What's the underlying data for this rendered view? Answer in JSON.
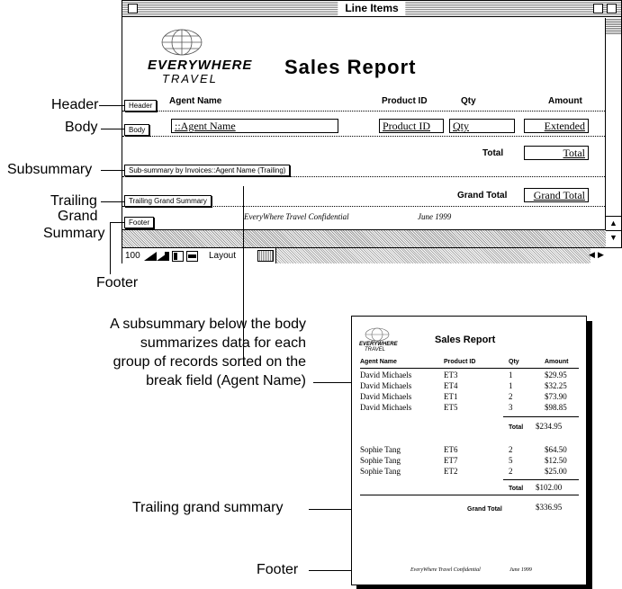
{
  "window": {
    "title": "Line Items",
    "logo_line1": "EVERYWHERE",
    "logo_line2": "TRAVEL",
    "report_title": "Sales Report",
    "headers": {
      "agent": "Agent Name",
      "product": "Product ID",
      "qty": "Qty",
      "amount": "Amount"
    },
    "part_tags": {
      "header": "Header",
      "body": "Body",
      "subsummary": "Sub-summary by Invoices::Agent Name (Trailing)",
      "grand": "Trailing Grand Summary",
      "footer": "Footer"
    },
    "fields": {
      "agent": "::Agent Name",
      "product": "Product ID",
      "qty": "Qty",
      "amount": "Extended",
      "total": "Total",
      "grand_total": "Grand Total"
    },
    "labels": {
      "total": "Total",
      "grand_total": "Grand Total"
    },
    "footer_text": "EveryWhere Travel Confidential",
    "footer_date": "June 1999",
    "status": {
      "zoom": "100",
      "mode": "Layout"
    }
  },
  "callouts": {
    "header": "Header",
    "body": "Body",
    "subsummary": "Subsummary",
    "trailing1": "Trailing",
    "trailing2": "Grand",
    "trailing3": "Summary",
    "footer": "Footer",
    "sub_desc_1": "A subsummary below the body",
    "sub_desc_2": "summarizes data for each",
    "sub_desc_3": "group of records sorted on the",
    "sub_desc_4": "break field (Agent Name)",
    "trailing_grand": "Trailing grand summary",
    "footer_bottom": "Footer"
  },
  "printed": {
    "logo_line1": "EVERYWHERE",
    "logo_line2": "TRAVEL",
    "title": "Sales Report",
    "headers": {
      "agent": "Agent Name",
      "product": "Product ID",
      "qty": "Qty",
      "amount": "Amount"
    },
    "group1": [
      {
        "agent": "David Michaels",
        "product": "ET3",
        "qty": "1",
        "amount": "$29.95"
      },
      {
        "agent": "David Michaels",
        "product": "ET4",
        "qty": "1",
        "amount": "$32.25"
      },
      {
        "agent": "David Michaels",
        "product": "ET1",
        "qty": "2",
        "amount": "$73.90"
      },
      {
        "agent": "David Michaels",
        "product": "ET5",
        "qty": "3",
        "amount": "$98.85"
      }
    ],
    "total1_label": "Total",
    "total1": "$234.95",
    "group2": [
      {
        "agent": "Sophie Tang",
        "product": "ET6",
        "qty": "2",
        "amount": "$64.50"
      },
      {
        "agent": "Sophie Tang",
        "product": "ET7",
        "qty": "5",
        "amount": "$12.50"
      },
      {
        "agent": "Sophie Tang",
        "product": "ET2",
        "qty": "2",
        "amount": "$25.00"
      }
    ],
    "total2_label": "Total",
    "total2": "$102.00",
    "grand_label": "Grand Total",
    "grand_total": "$336.95",
    "footer_text": "EveryWhere Travel Confidential",
    "footer_date": "June 1999"
  }
}
